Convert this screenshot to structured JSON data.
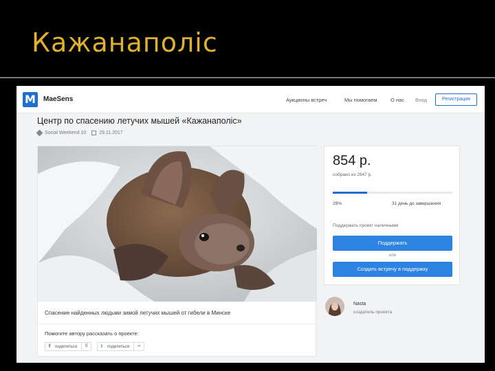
{
  "slide": {
    "title": "Кажанаполіс"
  },
  "site": {
    "logo_letter": "M",
    "logo_text": "MaeSens",
    "nav": {
      "auctions": "Аукционы встреч",
      "we_helped": "Мы помогаем",
      "about": "О нас",
      "login": "Вход",
      "register": "Регистрация"
    }
  },
  "project": {
    "title": "Центр по спасению летучих мышей «Кажанаполіс»",
    "category": "Social Weekend 10",
    "date": "29.11.2017",
    "caption": "Спасение найденных людьми зимой летучих мышей от гибели в Минске",
    "share_prompt": "Помогите автору рассказать о проекте:",
    "share": [
      {
        "icon": "f",
        "label": "поделиться",
        "count": "5"
      },
      {
        "icon": "t",
        "label": "поделиться",
        "count": "∞"
      }
    ]
  },
  "funding": {
    "amount": "854 р.",
    "collected": "собрано из 2947 р.",
    "progress_fraction": 0.29,
    "percent": "29%",
    "days_left": "31 день до завершения",
    "support_hint": "Поддержать проект наличными",
    "support_button": "Поддержать",
    "or": "или",
    "meeting_button": "Создать встречу в поддержку"
  },
  "author": {
    "name": "Nasta",
    "role": "создатель проекта"
  },
  "colors": {
    "accent": "#2e83e2",
    "title_gold": "#e0b12d"
  }
}
